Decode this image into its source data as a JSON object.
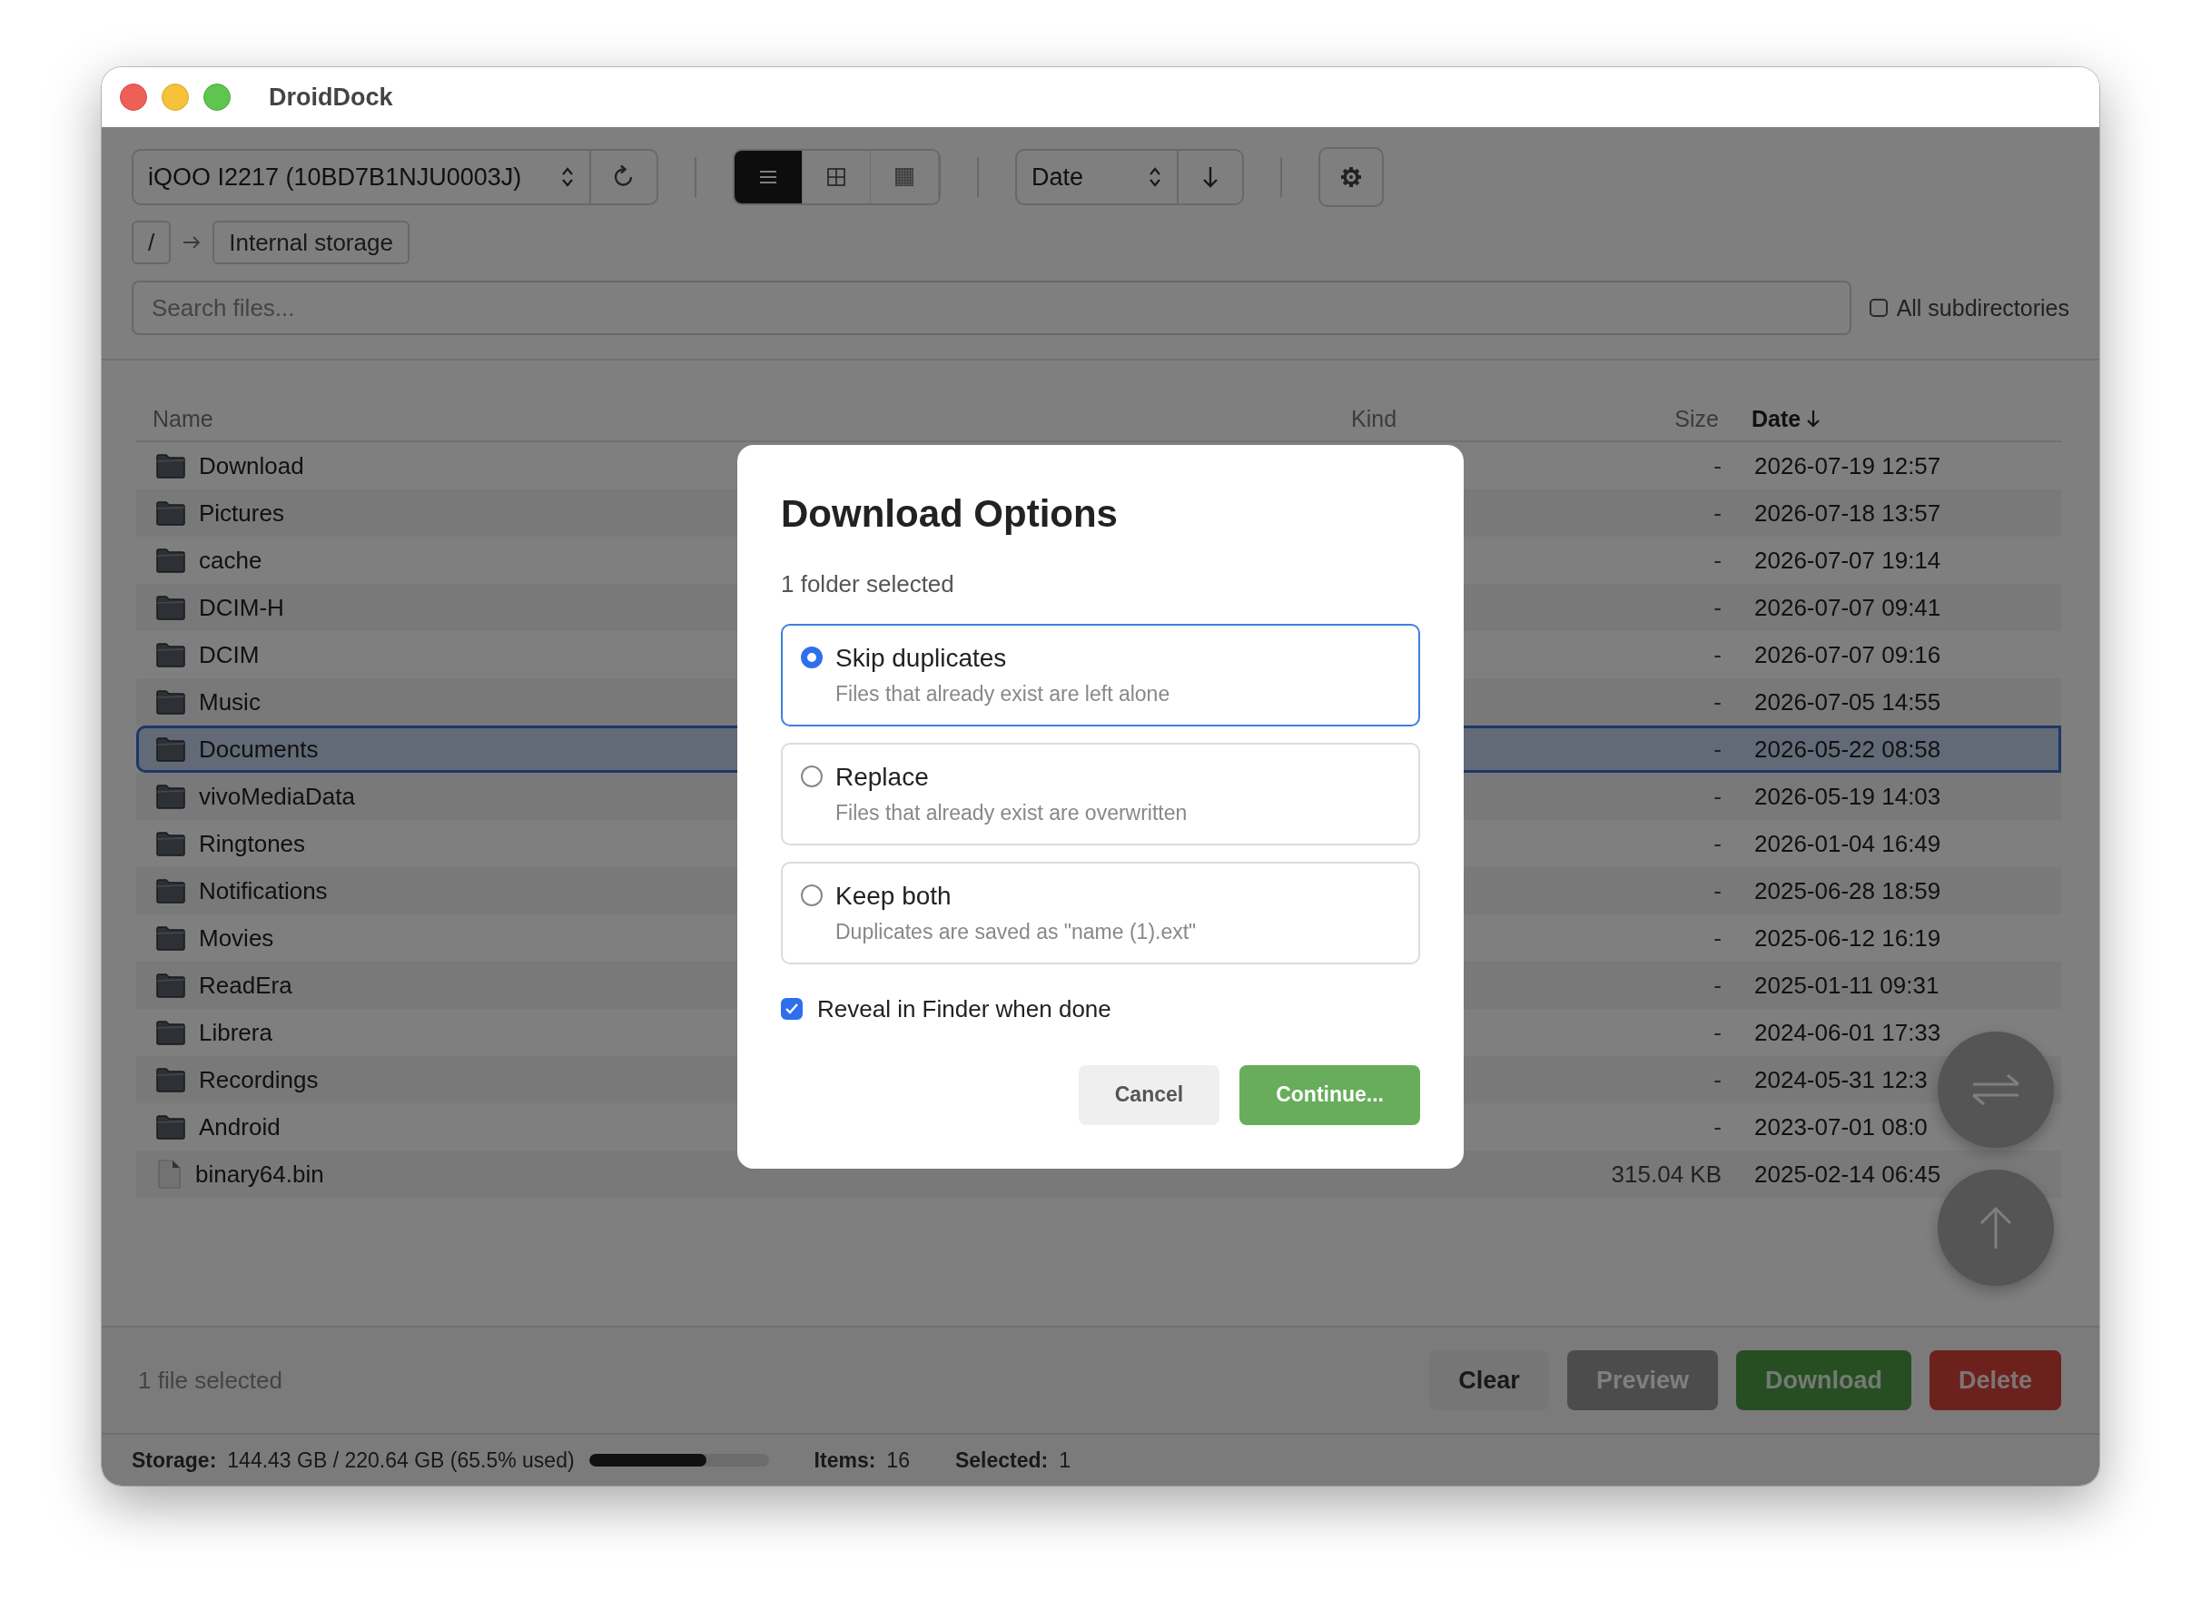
{
  "window": {
    "title": "DroidDock"
  },
  "toolbar": {
    "device": "iQOO I2217 (10BD7B1NJU0003J)",
    "view_modes": [
      {
        "kind": "list",
        "selected": true
      },
      {
        "kind": "grid",
        "selected": false
      },
      {
        "kind": "dense",
        "selected": false
      }
    ],
    "sort": "Date"
  },
  "breadcrumb": [
    {
      "label": "/"
    },
    {
      "label": "Internal storage"
    }
  ],
  "search": {
    "placeholder": "Search files...",
    "all_subdirectories": {
      "label": "All subdirectories",
      "checked": false
    }
  },
  "table": {
    "columns": [
      {
        "label": "Name",
        "sorted": false
      },
      {
        "label": "Kind",
        "sorted": false
      },
      {
        "label": "Size",
        "sorted": false
      },
      {
        "label": "Date",
        "sorted": true
      }
    ],
    "rows": [
      {
        "name": "Download",
        "kind": "folder",
        "size": "-",
        "date": "2026-07-19 12:57",
        "selected": false
      },
      {
        "name": "Pictures",
        "kind": "folder",
        "size": "-",
        "date": "2026-07-18 13:57",
        "selected": false
      },
      {
        "name": "cache",
        "kind": "folder",
        "size": "-",
        "date": "2026-07-07 19:14",
        "selected": false
      },
      {
        "name": "DCIM-H",
        "kind": "folder",
        "size": "-",
        "date": "2026-07-07 09:41",
        "selected": false
      },
      {
        "name": "DCIM",
        "kind": "folder",
        "size": "-",
        "date": "2026-07-07 09:16",
        "selected": false
      },
      {
        "name": "Music",
        "kind": "folder",
        "size": "-",
        "date": "2026-07-05 14:55",
        "selected": false
      },
      {
        "name": "Documents",
        "kind": "folder",
        "size": "-",
        "date": "2026-05-22 08:58",
        "selected": true
      },
      {
        "name": "vivoMediaData",
        "kind": "folder",
        "size": "-",
        "date": "2026-05-19 14:03",
        "selected": false
      },
      {
        "name": "Ringtones",
        "kind": "folder",
        "size": "-",
        "date": "2026-01-04 16:49",
        "selected": false
      },
      {
        "name": "Notifications",
        "kind": "folder",
        "size": "-",
        "date": "2025-06-28 18:59",
        "selected": false
      },
      {
        "name": "Movies",
        "kind": "folder",
        "size": "-",
        "date": "2025-06-12 16:19",
        "selected": false
      },
      {
        "name": "ReadEra",
        "kind": "folder",
        "size": "-",
        "date": "2025-01-11 09:31",
        "selected": false
      },
      {
        "name": "Librera",
        "kind": "folder",
        "size": "-",
        "date": "2024-06-01 17:33",
        "selected": false
      },
      {
        "name": "Recordings",
        "kind": "folder",
        "size": "-",
        "date": "2024-05-31 12:3",
        "selected": false
      },
      {
        "name": "Android",
        "kind": "folder",
        "size": "-",
        "date": "2023-07-01 08:0",
        "selected": false
      },
      {
        "name": "binary64.bin",
        "kind": "file",
        "size": "315.04 KB",
        "date": "2025-02-14 06:45",
        "selected": false
      }
    ]
  },
  "selection_summary": "1 file selected",
  "actions": [
    {
      "label": "Clear",
      "kind": "neutral"
    },
    {
      "label": "Preview",
      "kind": "muted"
    },
    {
      "label": "Download",
      "kind": "primary"
    },
    {
      "label": "Delete",
      "kind": "danger"
    }
  ],
  "status_bar": {
    "storage_label": "Storage:",
    "storage_value": "144.43 GB / 220.64 GB (65.5% used)",
    "level": 0.655,
    "items_label": "Items:",
    "items_value": "16",
    "selected_label": "Selected:",
    "selected_value": "1"
  },
  "dialog": {
    "title": "Download Options",
    "subtitle": "1 folder selected",
    "options": [
      {
        "label": "Skip duplicates",
        "description": "Files that already exist are left alone",
        "selected": true
      },
      {
        "label": "Replace",
        "description": "Files that already exist are overwritten",
        "selected": false
      },
      {
        "label": "Keep both",
        "description": "Duplicates are saved as \"name (1).ext\"",
        "selected": false
      }
    ],
    "reveal": {
      "label": "Reveal in Finder when done",
      "checked": true
    },
    "buttons": [
      {
        "label": "Cancel",
        "kind": "secondary"
      },
      {
        "label": "Continue...",
        "kind": "primary"
      }
    ]
  }
}
